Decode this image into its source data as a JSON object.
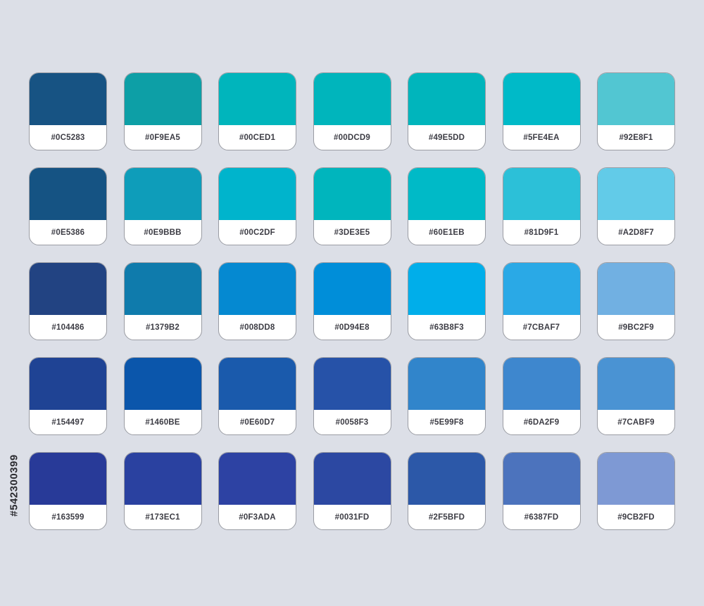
{
  "palette": {
    "rows": [
      [
        {
          "label": "#0C5283",
          "color": "#175383"
        },
        {
          "label": "#0F9EA5",
          "color": "#0d9fa6"
        },
        {
          "label": "#00CED1",
          "color": "#00b5bc"
        },
        {
          "label": "#00DCD9",
          "color": "#00b5bc"
        },
        {
          "label": "#49E5DD",
          "color": "#00b5bc"
        },
        {
          "label": "#5FE4EA",
          "color": "#00bac8"
        },
        {
          "label": "#92E8F1",
          "color": "#52c6d2"
        }
      ],
      [
        {
          "label": "#0E5386",
          "color": "#155383"
        },
        {
          "label": "#0E9BBB",
          "color": "#0e9dba"
        },
        {
          "label": "#00C2DF",
          "color": "#00b4cc"
        },
        {
          "label": "#3DE3E5",
          "color": "#00b5bd"
        },
        {
          "label": "#60E1EB",
          "color": "#00bac7"
        },
        {
          "label": "#81D9F1",
          "color": "#2cc0d8"
        },
        {
          "label": "#A2D8F7",
          "color": "#62cbe8"
        }
      ],
      [
        {
          "label": "#104486",
          "color": "#224382"
        },
        {
          "label": "#1379B2",
          "color": "#0f7bac"
        },
        {
          "label": "#008DD8",
          "color": "#0589d1"
        },
        {
          "label": "#0D94E8",
          "color": "#008ed9"
        },
        {
          "label": "#63B8F3",
          "color": "#00aeea"
        },
        {
          "label": "#7CBAF7",
          "color": "#2aa9e6"
        },
        {
          "label": "#9BC2F9",
          "color": "#71b0e2"
        }
      ],
      [
        {
          "label": "#154497",
          "color": "#1f4394"
        },
        {
          "label": "#1460BE",
          "color": "#0b56ab"
        },
        {
          "label": "#0E60D7",
          "color": "#1a5aac"
        },
        {
          "label": "#0058F3",
          "color": "#2652a8"
        },
        {
          "label": "#5E99F8",
          "color": "#3185cb"
        },
        {
          "label": "#6DA2F9",
          "color": "#3e87ce"
        },
        {
          "label": "#7CABF9",
          "color": "#4a93d3"
        }
      ],
      [
        {
          "label": "#163599",
          "color": "#283a98"
        },
        {
          "label": "#173EC1",
          "color": "#2a41a0"
        },
        {
          "label": "#0F3ADA",
          "color": "#2d42a3"
        },
        {
          "label": "#0031FD",
          "color": "#2c48a2"
        },
        {
          "label": "#2F5BFD",
          "color": "#2c58a8"
        },
        {
          "label": "#6387FD",
          "color": "#4c73bd"
        },
        {
          "label": "#9CB2FD",
          "color": "#7e99d4"
        }
      ]
    ]
  },
  "watermark": {
    "id": "#542300399"
  }
}
